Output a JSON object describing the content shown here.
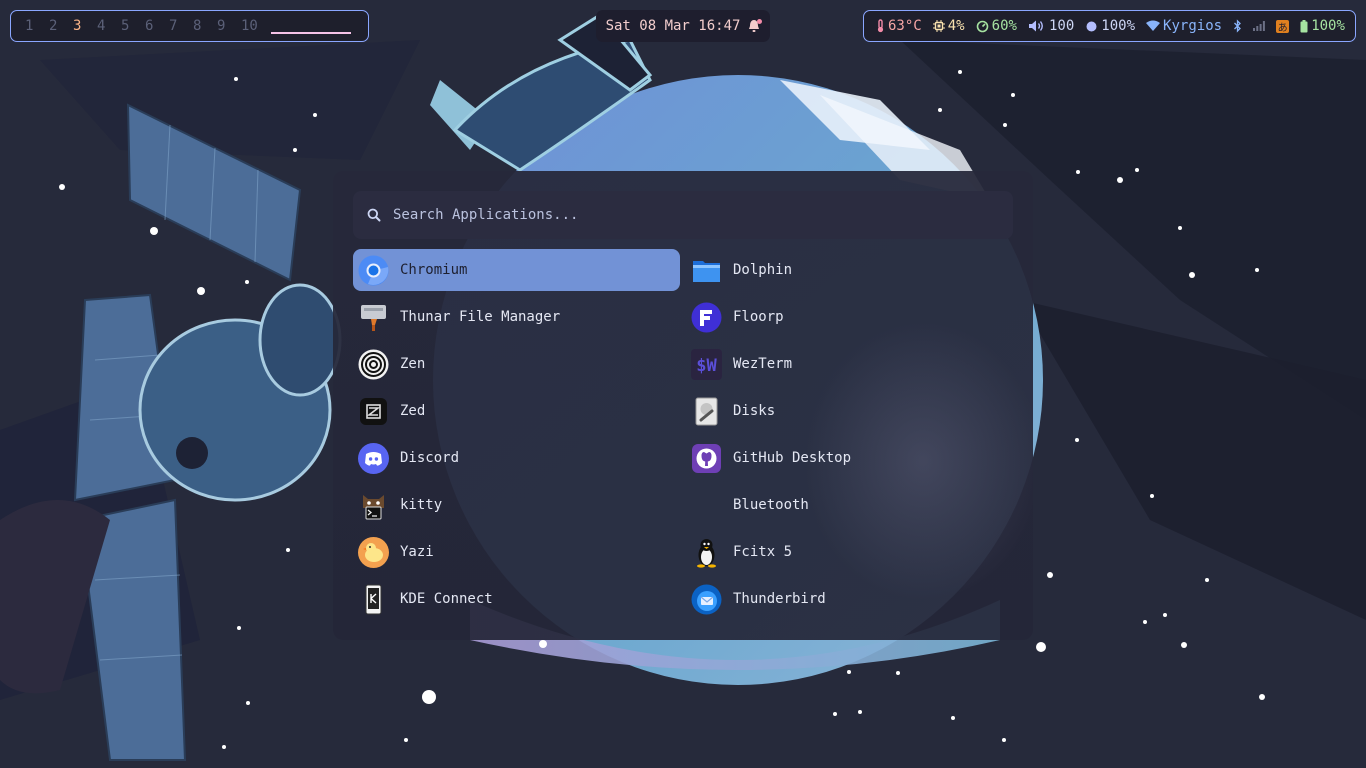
{
  "workspaces": {
    "items": [
      "1",
      "2",
      "3",
      "4",
      "5",
      "6",
      "7",
      "8",
      "9",
      "10"
    ],
    "active": "3"
  },
  "clock": {
    "text": "Sat 08 Mar 16:47"
  },
  "status": {
    "temperature": "63°C",
    "cpu": "4%",
    "memory": "60%",
    "volume": "100",
    "brightness": "100%",
    "network": "Kyrgios",
    "input_method": "あ",
    "battery": "100%"
  },
  "launcher": {
    "search_placeholder": "Search Applications...",
    "left_apps": [
      {
        "label": "Chromium",
        "icon": "chromium-icon"
      },
      {
        "label": "Thunar File Manager",
        "icon": "thunar-icon"
      },
      {
        "label": "Zen",
        "icon": "zen-icon"
      },
      {
        "label": "Zed",
        "icon": "zed-icon"
      },
      {
        "label": "Discord",
        "icon": "discord-icon"
      },
      {
        "label": "kitty",
        "icon": "kitty-icon"
      },
      {
        "label": "Yazi",
        "icon": "yazi-icon"
      },
      {
        "label": "KDE Connect",
        "icon": "kde-connect-icon"
      }
    ],
    "right_apps": [
      {
        "label": "Dolphin",
        "icon": "dolphin-icon"
      },
      {
        "label": "Floorp",
        "icon": "floorp-icon"
      },
      {
        "label": "WezTerm",
        "icon": "wezterm-icon"
      },
      {
        "label": "Disks",
        "icon": "disks-icon"
      },
      {
        "label": "GitHub Desktop",
        "icon": "github-desktop-icon"
      },
      {
        "label": "Bluetooth",
        "icon": "bluetooth-icon"
      },
      {
        "label": "Fcitx 5",
        "icon": "fcitx-icon"
      },
      {
        "label": "Thunderbird",
        "icon": "thunderbird-icon"
      }
    ],
    "selected": "Chromium"
  },
  "colors": {
    "bar_border": "#8aa6ff",
    "selected_row": "#7292d6",
    "active_workspace": "#fab387",
    "battery": "#a6e3a1"
  }
}
